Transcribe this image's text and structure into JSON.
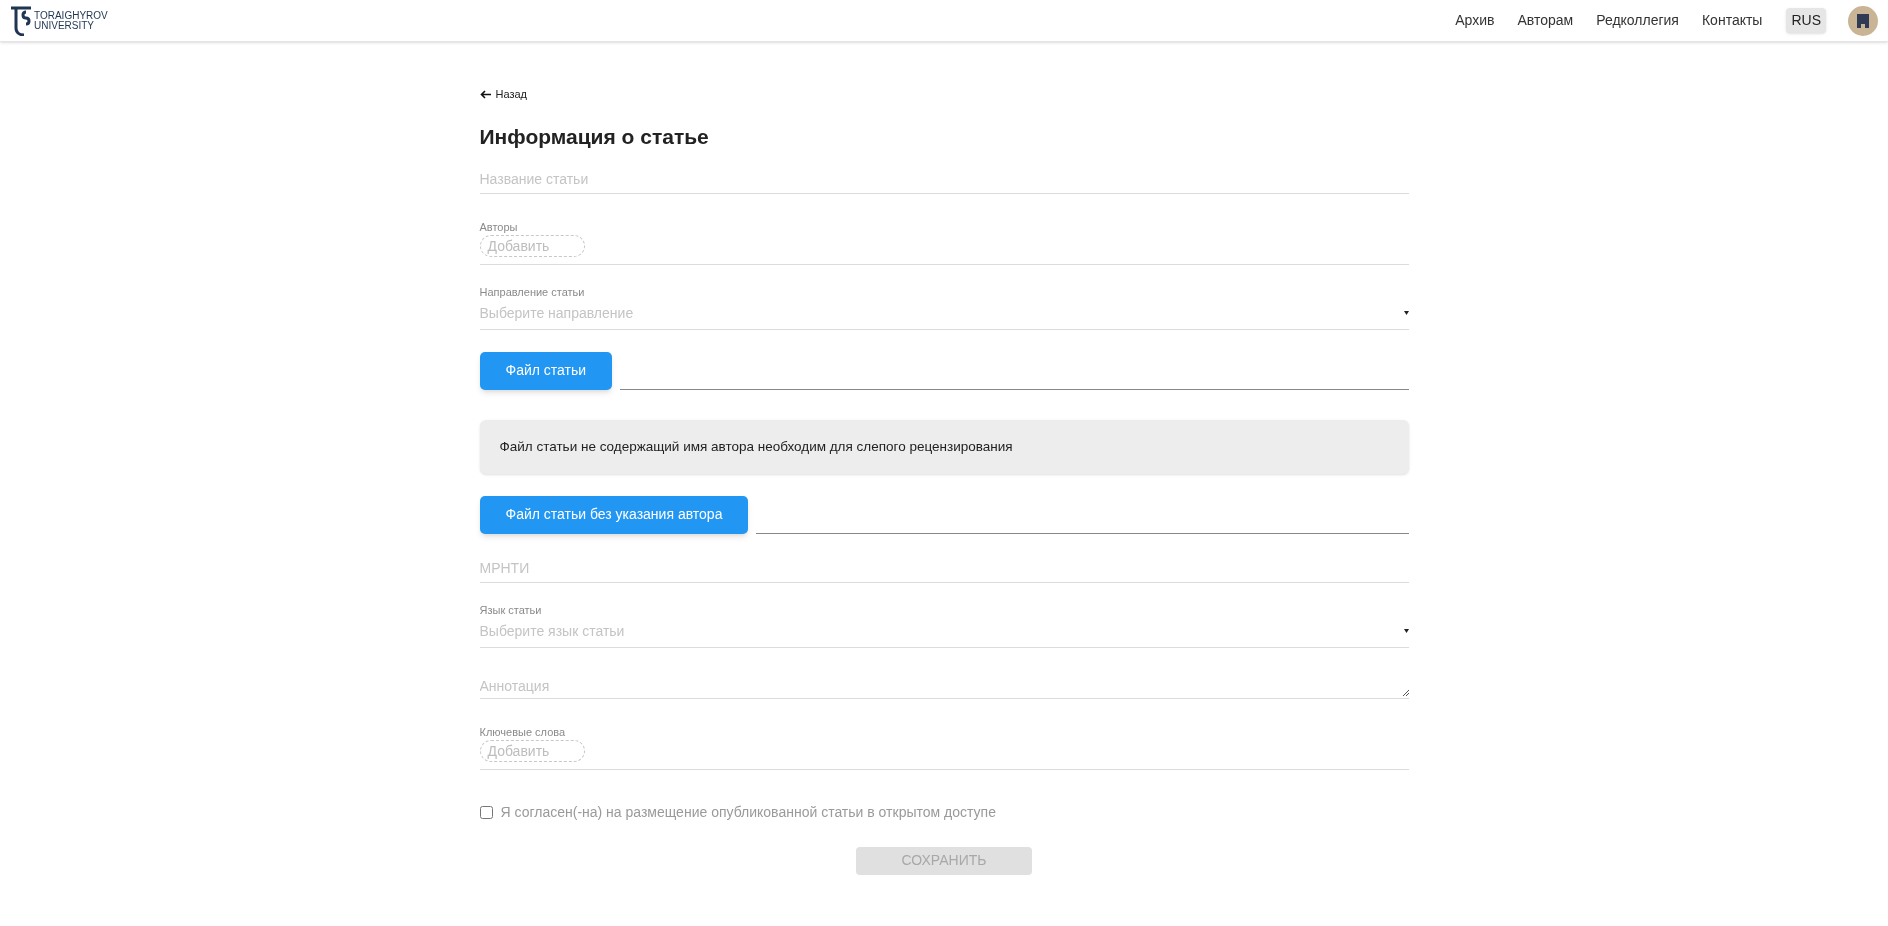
{
  "header": {
    "logo": {
      "line1": "TORAIGHYROV",
      "line2": "UNIVERSITY"
    },
    "nav": [
      {
        "label": "Архив"
      },
      {
        "label": "Авторам"
      },
      {
        "label": "Редколлегия"
      },
      {
        "label": "Контакты"
      }
    ],
    "language": "RUS"
  },
  "back": "Назад",
  "title": "Информация о статье",
  "fields": [
    {
      "kind": "text",
      "placeholder": "Название статьи"
    },
    {
      "kind": "chips",
      "label": "Авторы",
      "add": "Добавить"
    },
    {
      "kind": "select",
      "label": "Направление статьи",
      "placeholder": "Выберите направление"
    },
    {
      "kind": "file",
      "button": "Файл статьи"
    },
    {
      "kind": "note",
      "text": "Файл статьи не содержащий имя автора необходим для слепого рецензирования"
    },
    {
      "kind": "file",
      "button": "Файл статьи без указания автора"
    },
    {
      "kind": "text",
      "placeholder": "МРНТИ"
    },
    {
      "kind": "select",
      "label": "Язык статьи",
      "placeholder": "Выберите язык статьи"
    },
    {
      "kind": "textarea",
      "placeholder": "Аннотация"
    },
    {
      "kind": "chips",
      "label": "Ключевые слова",
      "add": "Добавить"
    },
    {
      "kind": "checkbox",
      "label": "Я согласен(-на) на размещение опубликованной статьи в открытом доступе",
      "checked": false
    }
  ],
  "save": {
    "label": "СОХРАНИТЬ",
    "disabled": true
  }
}
